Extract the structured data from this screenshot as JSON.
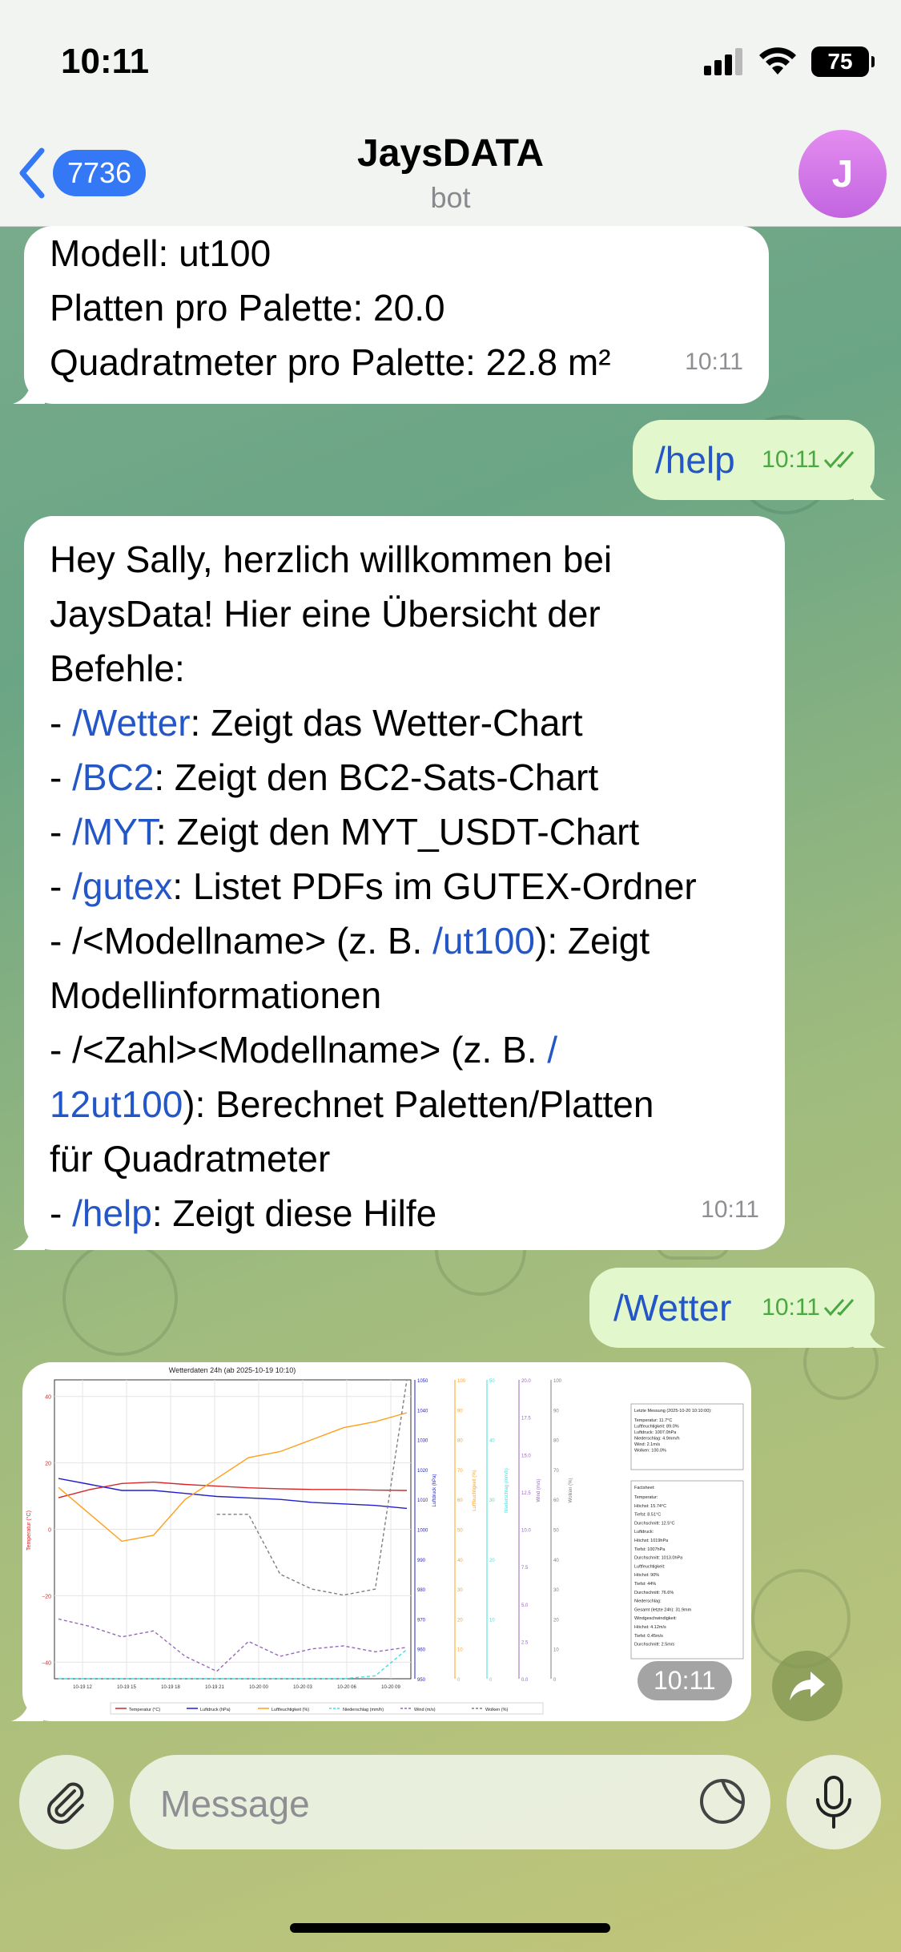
{
  "status_bar": {
    "time": "10:11",
    "battery": "75"
  },
  "header": {
    "back_count": "7736",
    "title": "JaysDATA",
    "subtitle": "bot",
    "avatar_letter": "J"
  },
  "messages": {
    "m1": {
      "lines": [
        "Modell: ut100",
        "Platten pro Palette: 20.0",
        "Quadratmeter pro Palette: 22.8 m²"
      ],
      "time": "10:11"
    },
    "m2": {
      "text": "/help",
      "time": "10:11"
    },
    "m3": {
      "l1": "Hey Sally, herzlich willkommen bei",
      "l2": "JaysData! Hier eine Übersicht der",
      "l3": "Befehle:",
      "l4_pre": "- ",
      "l4_cmd": "/Wetter",
      "l4_post": ": Zeigt das Wetter-Chart",
      "l5_pre": "- ",
      "l5_cmd": "/BC2",
      "l5_post": ": Zeigt den BC2-Sats-Chart",
      "l6_pre": "- ",
      "l6_cmd": "/MYT",
      "l6_post": ": Zeigt den MYT_USDT-Chart",
      "l7_pre": "- ",
      "l7_cmd": "/gutex",
      "l7_post": ": Listet PDFs im GUTEX-Ordner",
      "l8_pre": "- /<Modellname> (z. B. ",
      "l8_cmd": "/ut100",
      "l8_post": "): Zeigt",
      "l9": "Modellinformationen",
      "l10_pre": "- /<Zahl><Modellname> (z. B. ",
      "l10_cmd": "/",
      "l11_cmd": "12ut100",
      "l11_post": "): Berechnet Paletten/Platten",
      "l12": "für Quadratmeter",
      "l13_pre": "- ",
      "l13_cmd": "/help",
      "l13_post": ": Zeigt diese Hilfe",
      "time": "10:11"
    },
    "m4": {
      "text": "/Wetter",
      "time": "10:11"
    },
    "m5": {
      "time": "10:11"
    }
  },
  "chart_data": {
    "type": "line",
    "title": "Wetterdaten 24h (ab 2025-10-19 10:10)",
    "x_ticks": [
      "10-19 12",
      "10-19 15",
      "10-19 18",
      "10-19 21",
      "10-20 00",
      "10-20 03",
      "10-20 06",
      "10-20 09"
    ],
    "axes": [
      {
        "label": "Temperatur (°C)",
        "ticks": [
          "40",
          "20",
          "0",
          "−20",
          "−40"
        ],
        "color": "#d62728"
      },
      {
        "label": "Luftdruck (hPa)",
        "ticks": [
          "1050",
          "1040",
          "1030",
          "1020",
          "1010",
          "1000",
          "990",
          "980",
          "970",
          "960",
          "950"
        ],
        "color": "#1f1fcc"
      },
      {
        "label": "Luftfeuchtigkeit (%)",
        "ticks": [
          "100",
          "90",
          "80",
          "70",
          "60",
          "50",
          "40",
          "30",
          "20",
          "10",
          "0"
        ],
        "color": "#ff9f1a"
      },
      {
        "label": "Niederschlag (mm/h)",
        "ticks": [
          "50",
          "40",
          "30",
          "20",
          "10",
          "0"
        ],
        "color": "#3ee0e0"
      },
      {
        "label": "Wind (m/s)",
        "ticks": [
          "20.0",
          "17.5",
          "15.0",
          "12.5",
          "10.0",
          "7.5",
          "5.0",
          "2.5",
          "0.0"
        ],
        "color": "#9467bd"
      },
      {
        "label": "Wolken (%)",
        "ticks": [
          "100",
          "90",
          "80",
          "70",
          "60",
          "50",
          "40",
          "30",
          "20",
          "10",
          "0"
        ],
        "color": "#7f7f7f"
      }
    ],
    "series": [
      {
        "name": "Temperatur (°C)",
        "color": "#d62728",
        "values": [
          9.5,
          12,
          13.8,
          14.2,
          13.5,
          13,
          12.5,
          12.2,
          12,
          12,
          11.8,
          11.7
        ]
      },
      {
        "name": "Luftdruck (hPa)",
        "color": "#1f1fcc",
        "values": [
          1017,
          1015,
          1013,
          1013,
          1012,
          1011,
          1010.5,
          1010,
          1009,
          1008.5,
          1008,
          1007
        ]
      },
      {
        "name": "Luftfeuchtigkeit (%)",
        "color": "#ff9f1a",
        "values": [
          64,
          55,
          46,
          48,
          60,
          67,
          74,
          76,
          80,
          84,
          86,
          89
        ]
      },
      {
        "name": "Niederschlag (mm/h)",
        "color": "#3ee0e0",
        "values": [
          0,
          0,
          0,
          0,
          0,
          0,
          0,
          0,
          0,
          0,
          0.5,
          4.9
        ]
      },
      {
        "name": "Wind (m/s)",
        "color": "#9467bd",
        "values": [
          4,
          3.5,
          2.8,
          3.2,
          1.5,
          0.5,
          2.5,
          1.5,
          2,
          2.2,
          1.8,
          2.1
        ]
      },
      {
        "name": "Wolken (%)",
        "color": "#7f7f7f",
        "values": [
          null,
          null,
          null,
          null,
          null,
          55,
          55,
          35,
          30,
          28,
          30,
          100
        ]
      }
    ],
    "info_box": {
      "title": "Letzte Messung (2025-10-20 10:10:00):",
      "lines": [
        "Temperatur: 11.7°C",
        "Luftfeuchtigkeit: 89.0%",
        "Luftdruck: 1007.0hPa",
        "Niederschlag: 4.9mm/h",
        "Wind: 2.1m/s",
        "Wolken: 100.0%"
      ]
    },
    "factsheet": {
      "title": "Factsheet:",
      "lines": [
        "Temperatur:",
        "Höchst: 15.74°C",
        "Tiefst: 8.51°C",
        "Durchschnitt: 12.5°C",
        "Luftdruck:",
        "Höchst: 1019hPa",
        "Tiefst: 1007hPa",
        "Durchschnitt: 1013.0hPa",
        "Luftfeuchtigkeit:",
        "Höchst: 90%",
        "Tiefst: 44%",
        "Durchschnitt: 76.6%",
        "Niederschlag:",
        "Gesamt (letzte 24h): 31.9mm",
        "Windgeschwindigkeit:",
        "Höchst: 4.12m/s",
        "Tiefst: 0.45m/s",
        "Durchschnitt: 2.5m/s"
      ]
    }
  },
  "input": {
    "placeholder": "Message"
  }
}
